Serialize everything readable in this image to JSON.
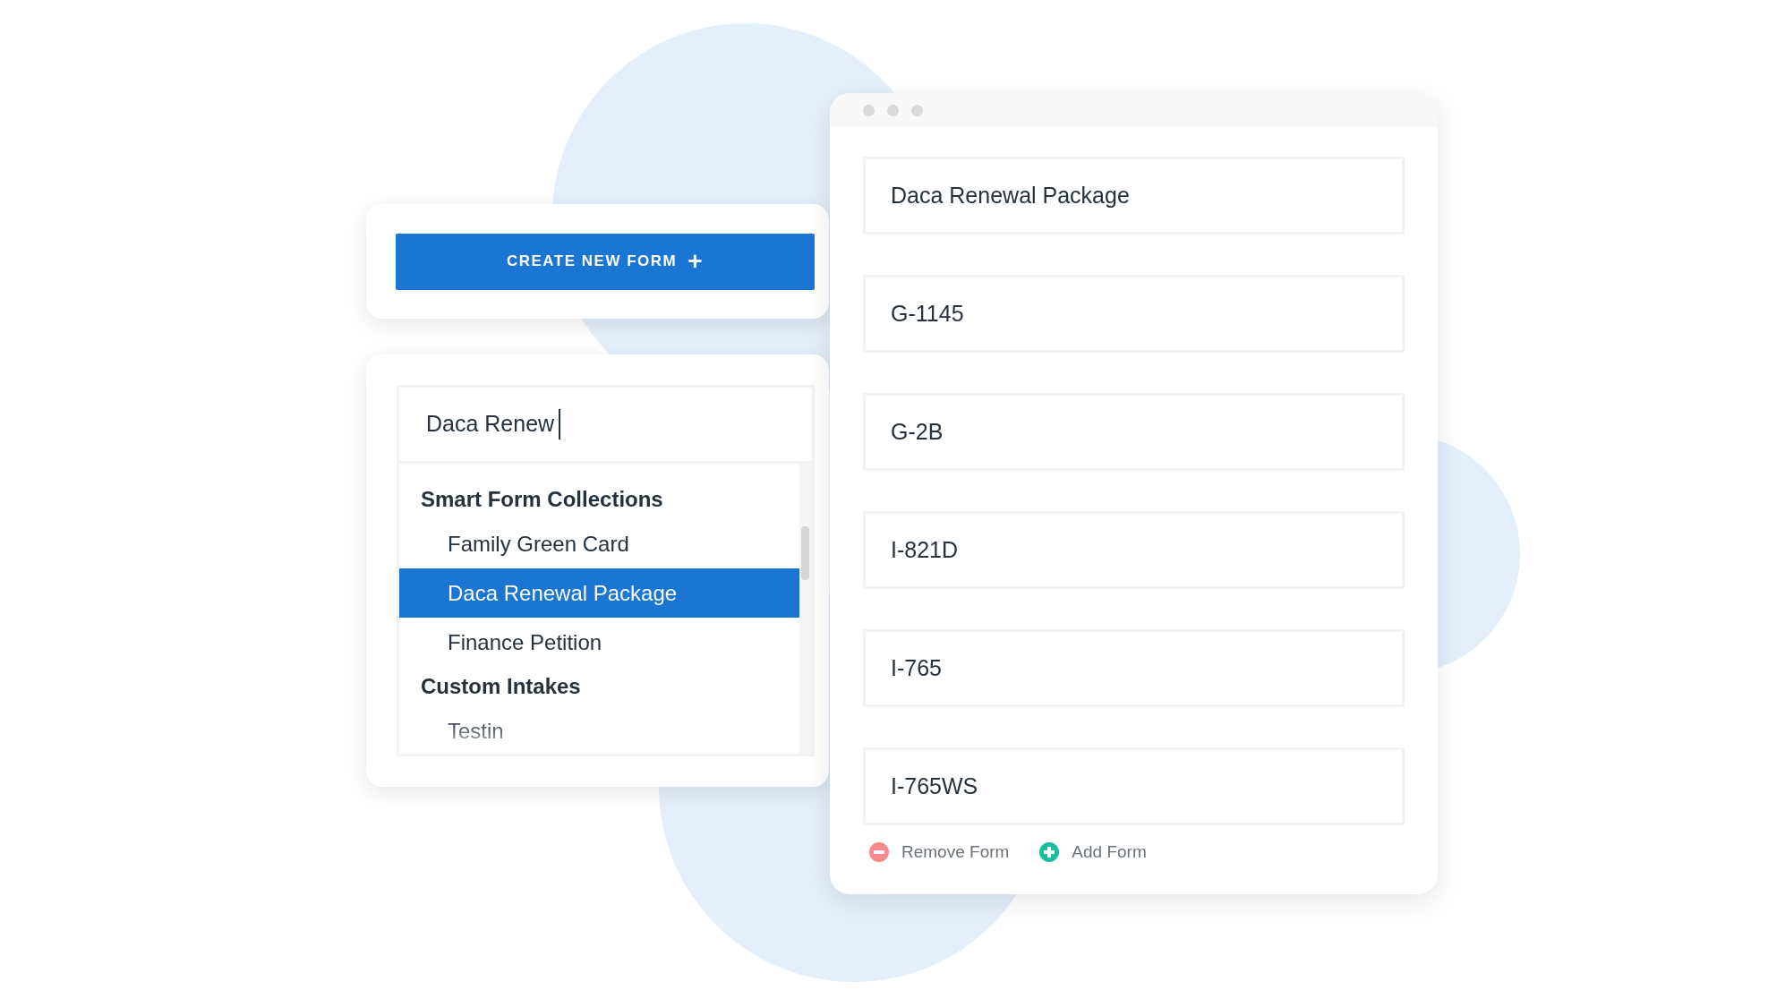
{
  "create_button": {
    "label": "CREATE NEW FORM",
    "icon": "+"
  },
  "search": {
    "value": "Daca Renew"
  },
  "results": [
    {
      "heading": "Smart Form Collections",
      "items": [
        {
          "label": "Family Green Card",
          "selected": false
        },
        {
          "label": "Daca Renewal Package",
          "selected": true
        },
        {
          "label": "Finance Petition",
          "selected": false
        }
      ]
    },
    {
      "heading": "Custom Intakes",
      "items": [
        {
          "label": "Testin",
          "selected": false
        }
      ]
    }
  ],
  "forms": [
    "Daca Renewal Package",
    "G-1145",
    "G-2B",
    "I-821D",
    "I-765",
    "I-765WS"
  ],
  "actions": [
    {
      "kind": "remove",
      "label": "Remove Form"
    },
    {
      "kind": "add",
      "label": "Add Form"
    }
  ]
}
